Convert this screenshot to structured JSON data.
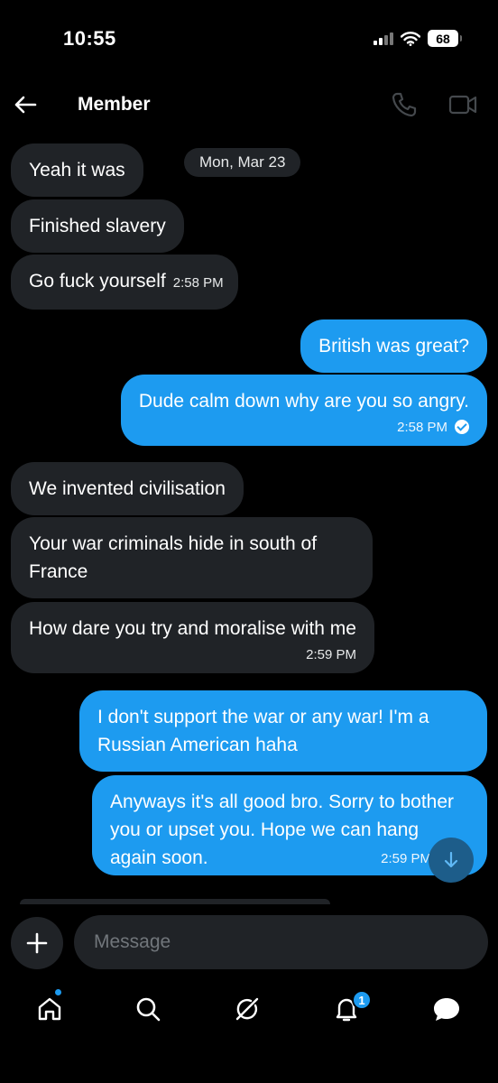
{
  "status_bar": {
    "time": "10:55",
    "battery": "68"
  },
  "header": {
    "title": "Member"
  },
  "date_separator": "Mon, Mar 23",
  "messages": [
    {
      "text": "Yeah it was"
    },
    {
      "text": "Finished slavery"
    },
    {
      "text": "Go fuck yourself",
      "time": "2:58 PM"
    },
    {
      "text": "British was great?"
    },
    {
      "text": "Dude calm down why are you so angry.",
      "time": "2:58 PM"
    },
    {
      "text": "We invented civilisation"
    },
    {
      "text": "Your war criminals hide in south of France"
    },
    {
      "text": "How dare you try and moralise with me",
      "time": "2:59 PM"
    },
    {
      "text": "I don't support the war or any war! I'm a Russian American haha"
    },
    {
      "text": "Anyways it's all good bro. Sorry to bother you or upset you. Hope we can hang again soon.",
      "time": "2:59 PM"
    }
  ],
  "composer": {
    "placeholder": "Message"
  },
  "nav": {
    "notifications_badge": "1"
  },
  "colors": {
    "accent": "#1d9bf0",
    "incoming_bubble": "#202327",
    "background": "#000000"
  }
}
